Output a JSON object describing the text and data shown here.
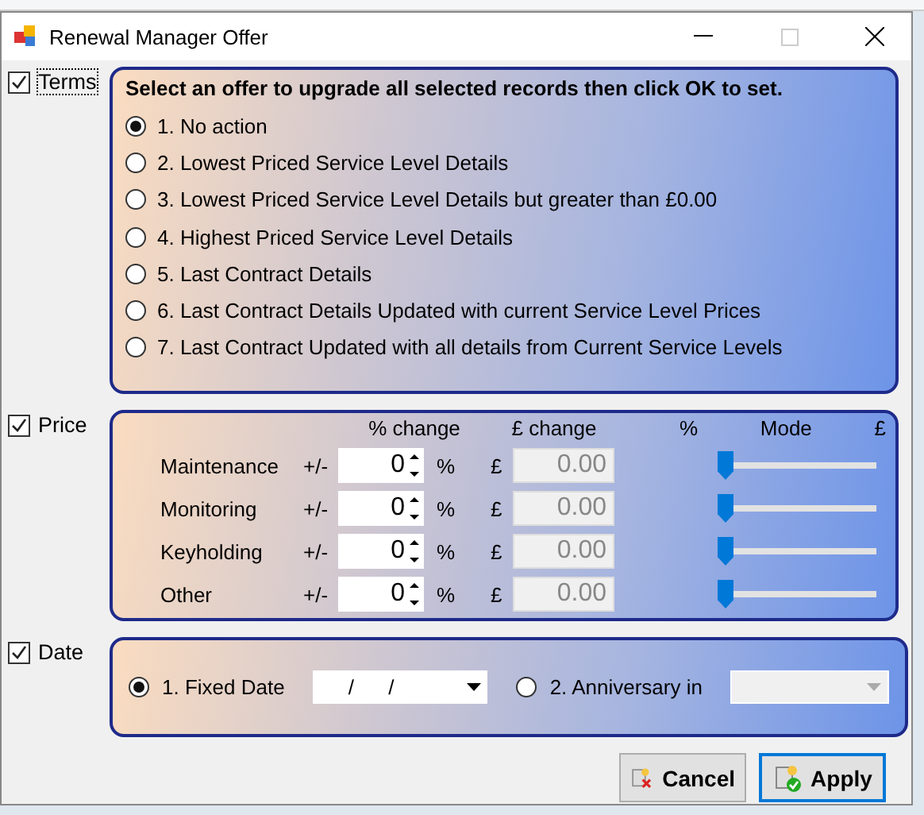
{
  "window": {
    "title": "Renewal Manager Offer"
  },
  "terms": {
    "label": "Terms",
    "checked": true,
    "heading": "Select an offer to upgrade all selected records then click OK to set.",
    "options": [
      {
        "label": "1. No action",
        "selected": true
      },
      {
        "label": "2. Lowest Priced Service Level Details",
        "selected": false
      },
      {
        "label": "3. Lowest Priced Service Level Details but greater than £0.00",
        "selected": false
      },
      {
        "label": "4. Highest Priced Service Level Details",
        "selected": false
      },
      {
        "label": "5. Last Contract Details",
        "selected": false
      },
      {
        "label": "6. Last Contract Details Updated with current Service Level Prices",
        "selected": false
      },
      {
        "label": "7. Last Contract Updated with all details from Current Service Levels",
        "selected": false
      }
    ]
  },
  "price": {
    "label": "Price",
    "checked": true,
    "columns": {
      "percent_change": "% change",
      "pound_change": "£ change",
      "percent": "%",
      "mode": "Mode",
      "pound": "£"
    },
    "rows": [
      {
        "name": "Maintenance",
        "sign": "+/-",
        "percent": "0",
        "percent_unit": "%",
        "pound_unit": "£",
        "amount": "0.00",
        "level": 0
      },
      {
        "name": "Monitoring",
        "sign": "+/-",
        "percent": "0",
        "percent_unit": "%",
        "pound_unit": "£",
        "amount": "0.00",
        "level": 0
      },
      {
        "name": "Keyholding",
        "sign": "+/-",
        "percent": "0",
        "percent_unit": "%",
        "pound_unit": "£",
        "amount": "0.00",
        "level": 0
      },
      {
        "name": "Other",
        "sign": "+/-",
        "percent": "0",
        "percent_unit": "%",
        "pound_unit": "£",
        "amount": "0.00",
        "level": 0
      }
    ]
  },
  "date": {
    "label": "Date",
    "checked": true,
    "options": [
      {
        "label": "1. Fixed Date",
        "selected": true,
        "value": "/      /"
      },
      {
        "label": "2. Anniversary in",
        "selected": false
      }
    ]
  },
  "buttons": [
    {
      "label": "Cancel",
      "kind": "cancel",
      "focused": false
    },
    {
      "label": "Apply",
      "kind": "apply",
      "focused": true
    }
  ]
}
